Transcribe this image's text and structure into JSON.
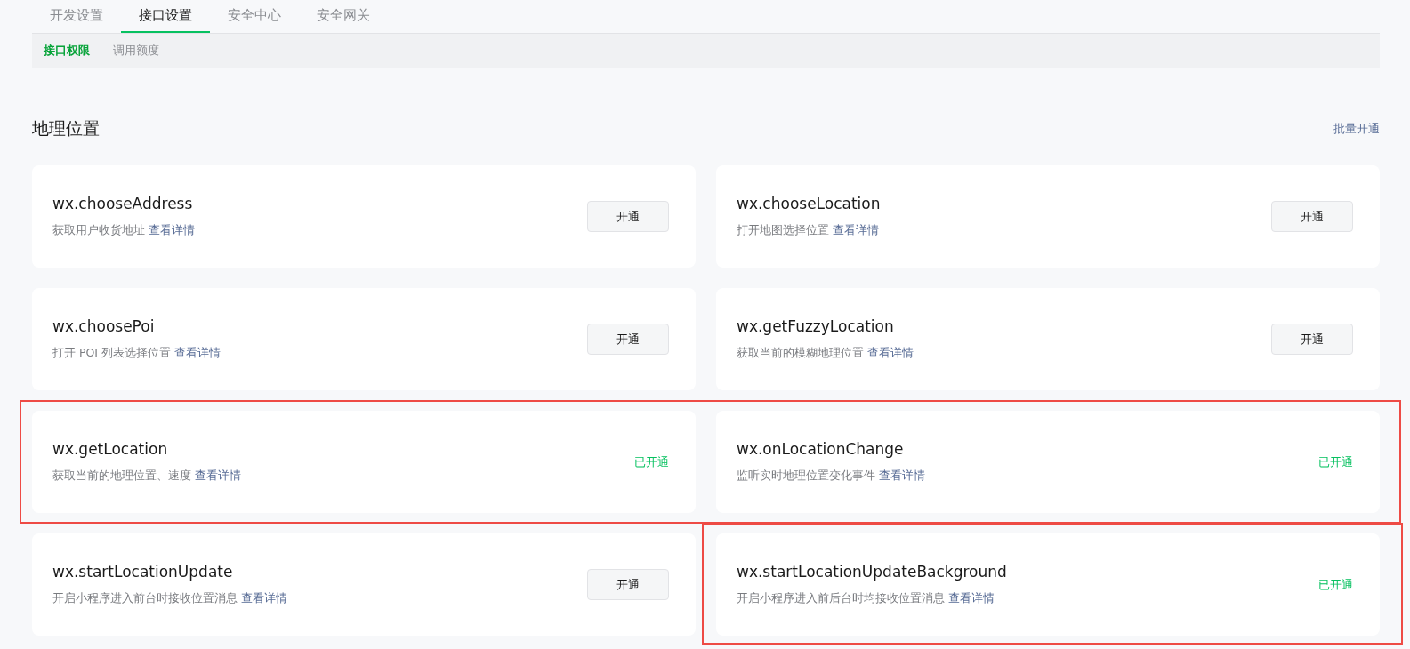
{
  "tabs": [
    {
      "label": "开发设置",
      "selected": false
    },
    {
      "label": "接口设置",
      "selected": true
    },
    {
      "label": "安全中心",
      "selected": false
    },
    {
      "label": "安全网关",
      "selected": false
    }
  ],
  "subtabs": [
    {
      "label": "接口权限",
      "selected": true
    },
    {
      "label": "调用额度",
      "selected": false
    }
  ],
  "section": {
    "title": "地理位置",
    "action": "批量开通"
  },
  "rows": [
    {
      "marked": false,
      "cards": [
        {
          "name": "wx.chooseAddress",
          "desc": "获取用户收货地址",
          "link": "查看详情",
          "enabled": false,
          "button": "开通",
          "marked": false
        },
        {
          "name": "wx.chooseLocation",
          "desc": "打开地图选择位置",
          "link": "查看详情",
          "enabled": false,
          "button": "开通",
          "marked": false
        }
      ]
    },
    {
      "marked": false,
      "cards": [
        {
          "name": "wx.choosePoi",
          "desc": "打开 POI 列表选择位置",
          "link": "查看详情",
          "enabled": false,
          "button": "开通",
          "marked": false
        },
        {
          "name": "wx.getFuzzyLocation",
          "desc": "获取当前的模糊地理位置",
          "link": "查看详情",
          "enabled": false,
          "button": "开通",
          "marked": false
        }
      ]
    },
    {
      "marked": true,
      "cards": [
        {
          "name": "wx.getLocation",
          "desc": "获取当前的地理位置、速度",
          "link": "查看详情",
          "enabled": true,
          "status": "已开通",
          "marked": false
        },
        {
          "name": "wx.onLocationChange",
          "desc": "监听实时地理位置变化事件",
          "link": "查看详情",
          "enabled": true,
          "status": "已开通",
          "marked": false
        }
      ]
    },
    {
      "marked": false,
      "cards": [
        {
          "name": "wx.startLocationUpdate",
          "desc": "开启小程序进入前台时接收位置消息",
          "link": "查看详情",
          "enabled": false,
          "button": "开通",
          "marked": false
        },
        {
          "name": "wx.startLocationUpdateBackground",
          "desc": "开启小程序进入前后台时均接收位置消息",
          "link": "查看详情",
          "enabled": true,
          "status": "已开通",
          "marked": true
        }
      ]
    }
  ]
}
